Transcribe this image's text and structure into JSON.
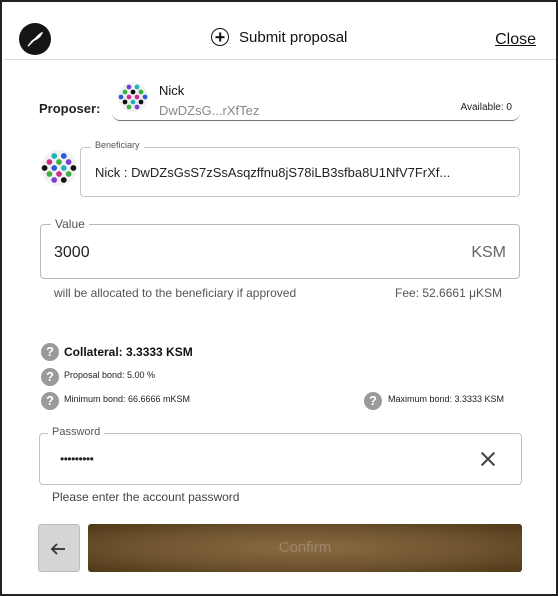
{
  "header": {
    "title": "Submit proposal",
    "close_label": "Close"
  },
  "proposer": {
    "label": "Proposer:",
    "name": "Nick",
    "address": "DwDZsG...rXfTez",
    "available": "Available: 0"
  },
  "beneficiary": {
    "legend": "Beneficiary",
    "value": "Nick :    DwDZsGsS7zSsAsqzffnu8jS78iLB3sfba8U1NfV7FrXf..."
  },
  "value_field": {
    "legend": "Value",
    "amount": "3000",
    "unit": "KSM",
    "hint": "will be allocated to the beneficiary if approved",
    "fee": "Fee: 52.6661 μKSM"
  },
  "bonds": {
    "collateral": "Collateral: 3.3333 KSM",
    "proposal_bond": "Proposal bond: 5.00 %",
    "minimum_bond": "Minimum bond: 66.6666 mKSM",
    "maximum_bond": "Maximum bond: 3.3333 KSM",
    "help_glyph": "?"
  },
  "password": {
    "legend": "Password",
    "value": "•••••••••",
    "hint": "Please enter the account password"
  },
  "actions": {
    "confirm_label": "Confirm"
  },
  "icons": {
    "logo": "bird-logo-icon",
    "submit": "plus-circle-icon",
    "clear": "close-x-icon",
    "back": "arrow-left-icon"
  },
  "colors": {
    "confirm_button": "#6f542f",
    "confirm_text": "#9d8768",
    "help_icon": "#9a9a9a"
  }
}
